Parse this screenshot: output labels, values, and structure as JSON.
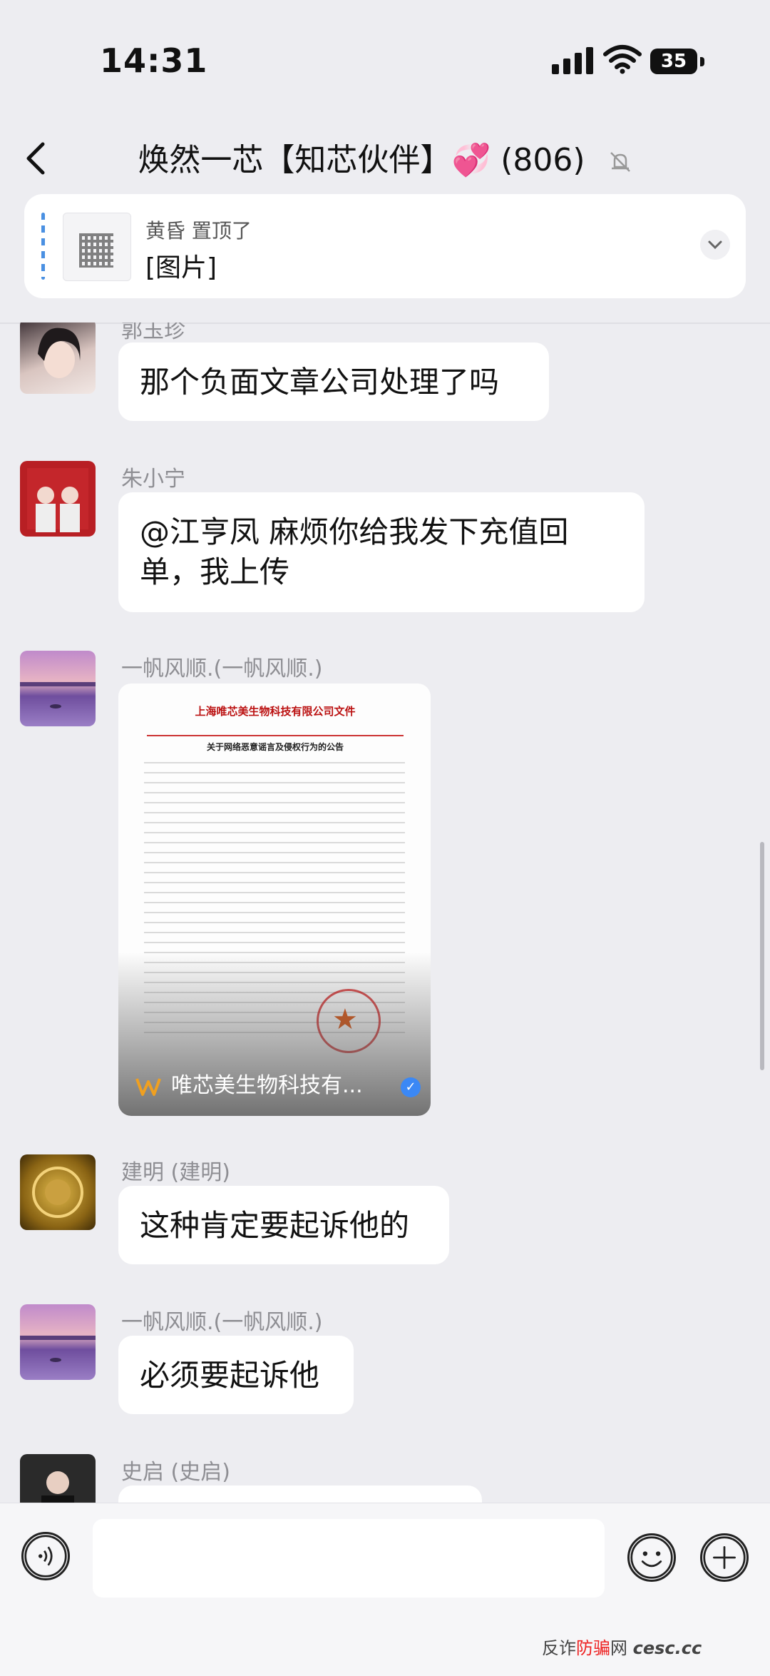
{
  "status": {
    "time": "14:31",
    "battery": "35"
  },
  "header": {
    "title_prefix": "焕然一芯【知芯伙伴】",
    "title_suffix": "(806)",
    "heart": "💞"
  },
  "pinned": {
    "sender_line": "黄昏 置顶了",
    "content": "[图片]"
  },
  "messages": [
    {
      "sender": "郭玉珍",
      "text": "那个负面文章公司处理了吗"
    },
    {
      "sender": "朱小宁",
      "text": "@江亨凤 麻烦你给我发下充值回单，我上传"
    },
    {
      "sender": "一帆风顺.(一帆风顺.)",
      "doc_title": "上海唯芯美生物科技有限公司文件",
      "doc_subtitle": "关于网络恶意谣言及侵权行为的公告",
      "doc_source": "唯芯美生物科技有..."
    },
    {
      "sender": "建明 (建明)",
      "text": "这种肯定要起诉他的"
    },
    {
      "sender": "一帆风顺.(一帆风顺.)",
      "text": "必须要起诉他"
    },
    {
      "sender": "史启 (史启)",
      "text": ""
    }
  ],
  "watermark": {
    "prefix": "反诈",
    "highlight": "防骗",
    "suffix": "网",
    "domain": "cesc.cc"
  },
  "colors": {
    "background": "#ededf1",
    "bubble": "#ffffff",
    "accent": "#3b88f5",
    "name_gray": "#8e8e93"
  },
  "icons": [
    "back-chevron-icon",
    "mute-bell-icon",
    "signal-icon",
    "wifi-icon",
    "battery-icon",
    "chevron-down-icon",
    "voice-icon",
    "emoji-icon",
    "plus-icon",
    "verified-icon"
  ]
}
